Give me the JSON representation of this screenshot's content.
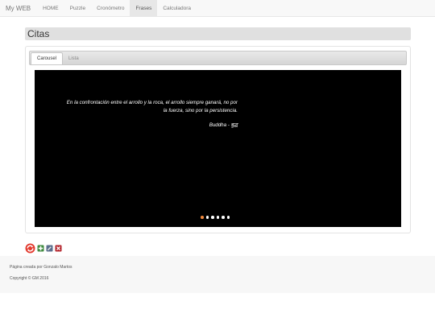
{
  "navbar": {
    "brand": "My WEB",
    "items": [
      {
        "label": "HOME",
        "active": false
      },
      {
        "label": "Puzzle",
        "active": false
      },
      {
        "label": "Cronómetro",
        "active": false
      },
      {
        "label": "Frases",
        "active": true
      },
      {
        "label": "Calculadora",
        "active": false
      }
    ]
  },
  "page": {
    "title": "Citas"
  },
  "tabs": [
    {
      "label": "Carousel",
      "active": true
    },
    {
      "label": "Lista",
      "active": false
    }
  ],
  "carousel": {
    "quote": "En la confrontación entre el arrollo y la roca, el arrollo siempre ganará, no por la fuerza, sino por la persistencia.",
    "author": "Buddha - बुद्ध",
    "slide_count": 6,
    "active_index": 0,
    "colors": {
      "background": "#000000",
      "indicator": "#ffffff",
      "indicator_active": "#f0883c"
    }
  },
  "toolbar": {
    "icons": [
      "refresh-icon",
      "add-icon",
      "edit-icon",
      "delete-icon"
    ]
  },
  "footer": {
    "line1": "Página creada por Gonzalo Martos",
    "line2": "Copyright © GM 2016"
  }
}
